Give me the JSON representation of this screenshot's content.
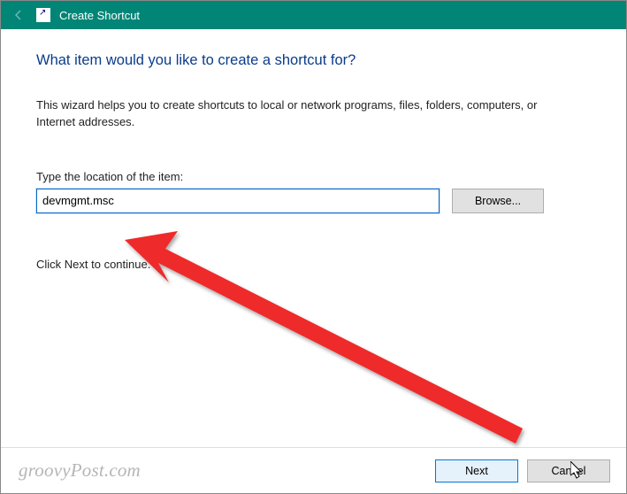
{
  "titlebar": {
    "title": "Create Shortcut"
  },
  "main": {
    "heading": "What item would you like to create a shortcut for?",
    "description": "This wizard helps you to create shortcuts to local or network programs, files, folders, computers, or Internet addresses.",
    "field_label": "Type the location of the item:",
    "location_value": "devmgmt.msc",
    "browse_label": "Browse...",
    "continue_hint": "Click Next to continue."
  },
  "footer": {
    "watermark": "groovyPost.com",
    "next_label": "Next",
    "cancel_label": "Cancel"
  }
}
